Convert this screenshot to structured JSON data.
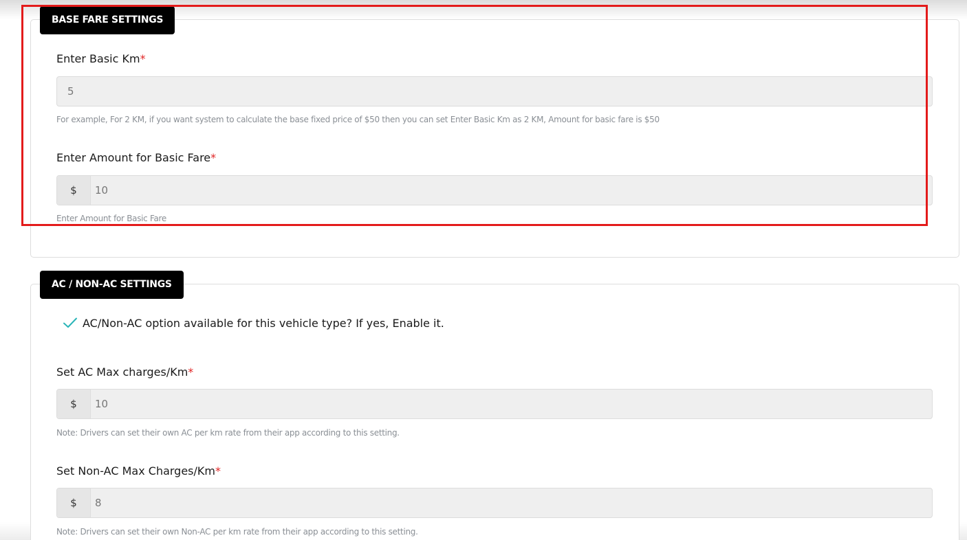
{
  "base_fare": {
    "section_title": "BASE FARE SETTINGS",
    "basic_km": {
      "label": "Enter Basic Km",
      "required_mark": "*",
      "value": "5",
      "help": "For example, For 2 KM, if you want system to calculate the base fixed price of $50 then you can set Enter Basic Km as 2 KM, Amount for basic fare is $50"
    },
    "basic_fare_amount": {
      "label": "Enter Amount for Basic Fare",
      "required_mark": "*",
      "currency": "$",
      "value": "10",
      "help": "Enter Amount for Basic Fare"
    }
  },
  "ac_settings": {
    "section_title": "AC / NON-AC SETTINGS",
    "enable_option": {
      "checked": true,
      "icon": "check-icon",
      "label": "AC/Non-AC option available for this vehicle type? If yes, Enable it."
    },
    "ac_max_charges": {
      "label": "Set AC Max charges/Km",
      "required_mark": "*",
      "currency": "$",
      "value": "10",
      "help": "Note: Drivers can set their own AC per km rate from their app according to this setting."
    },
    "non_ac_max_charges": {
      "label": "Set Non-AC Max Charges/Km",
      "required_mark": "*",
      "currency": "$",
      "value": "8",
      "help": "Note: Drivers can set their own Non-AC per km rate from their app according to this setting."
    }
  },
  "colors": {
    "highlight_border": "#e31b1b",
    "required": "#e02424",
    "check": "#2bb5b8",
    "tag_background": "#000000"
  }
}
